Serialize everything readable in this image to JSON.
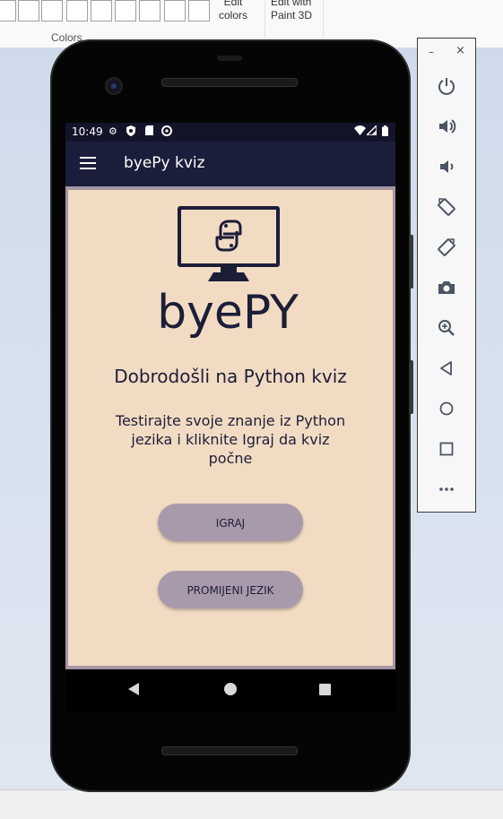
{
  "ribbon": {
    "edit_colors": "Edit\ncolors",
    "edit_colors_l1": "Edit",
    "edit_colors_l2": "colors",
    "edit_paint3d_l1": "Edit with",
    "edit_paint3d_l2": "Paint 3D",
    "colors_group": "Colors"
  },
  "status_bar": {
    "time": "10:49"
  },
  "app_bar": {
    "title": "byePy kviz"
  },
  "logo": {
    "text": "byePY"
  },
  "main": {
    "welcome": "Dobrodošli na Python kviz",
    "description": "Testirajte svoje znanje iz Python jezika i kliknite Igraj da kviz počne",
    "play_button": "IGRAJ",
    "language_button": "PROMIJENI JEZIK"
  },
  "colors": {
    "status_bar_bg": "#13142a",
    "app_bar_bg": "#1a1e3a",
    "content_bg": "#f2dbc3",
    "button_bg": "#a99aab",
    "text_dark": "#1c1e38"
  },
  "emulator_toolbar": {
    "minimize": "–",
    "close": "×",
    "icons": [
      "power-icon",
      "volume-up-icon",
      "volume-down-icon",
      "rotate-left-icon",
      "rotate-right-icon",
      "camera-icon",
      "zoom-icon",
      "back-icon",
      "home-icon",
      "overview-icon",
      "more-icon"
    ]
  }
}
